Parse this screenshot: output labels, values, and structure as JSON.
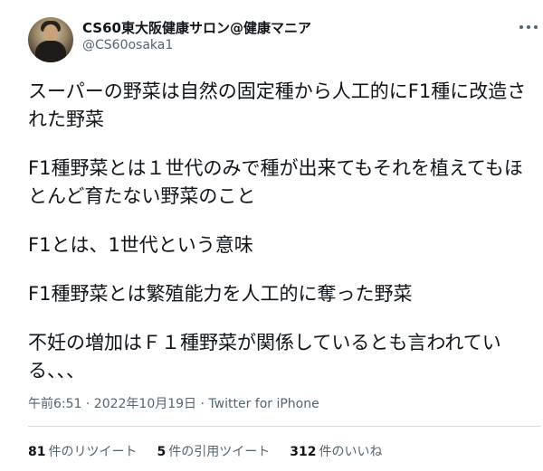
{
  "author": {
    "display_name": "CS60東大阪健康サロン@健康マニア",
    "handle": "@CS60osaka1"
  },
  "tweet": {
    "paragraphs": [
      "スーパーの野菜は自然の固定種から人工的にF1種に改造された野菜",
      "F1種野菜とは１世代のみで種が出来てもそれを植えてもほとんど育たない野菜のこと",
      "F1とは、1世代という意味",
      "F1種野菜とは繁殖能力を人工的に奪った野菜",
      "不妊の増加はＦ１種野菜が関係しているとも言われている、、、"
    ],
    "timestamp": "午前6:51 · 2022年10月19日 · Twitter for iPhone"
  },
  "stats": {
    "retweets_count": "81",
    "retweets_label": "件のリツイート",
    "quotes_count": "5",
    "quotes_label": "件の引用ツイート",
    "likes_count": "312",
    "likes_label": "件のいいね"
  }
}
